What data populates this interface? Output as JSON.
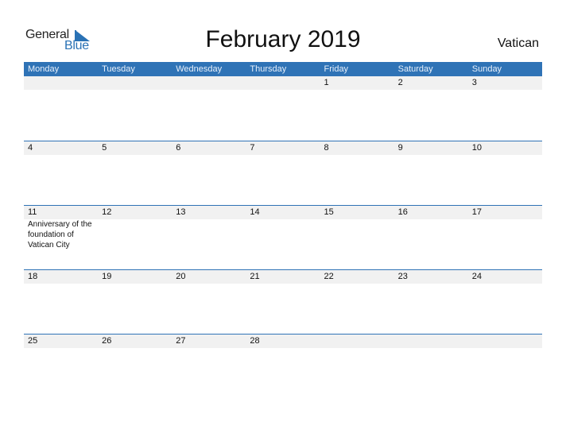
{
  "logo": {
    "word1": "General",
    "word2": "Blue"
  },
  "title": "February 2019",
  "country": "Vatican",
  "colors": {
    "header_bg": "#2f73b6",
    "date_strip_bg": "#f1f1f1",
    "logo_blue": "#2a72b5"
  },
  "weekdays": [
    "Monday",
    "Tuesday",
    "Wednesday",
    "Thursday",
    "Friday",
    "Saturday",
    "Sunday"
  ],
  "weeks": [
    {
      "days": [
        {
          "num": "",
          "event": ""
        },
        {
          "num": "",
          "event": ""
        },
        {
          "num": "",
          "event": ""
        },
        {
          "num": "",
          "event": ""
        },
        {
          "num": "1",
          "event": ""
        },
        {
          "num": "2",
          "event": ""
        },
        {
          "num": "3",
          "event": ""
        }
      ]
    },
    {
      "days": [
        {
          "num": "4",
          "event": ""
        },
        {
          "num": "5",
          "event": ""
        },
        {
          "num": "6",
          "event": ""
        },
        {
          "num": "7",
          "event": ""
        },
        {
          "num": "8",
          "event": ""
        },
        {
          "num": "9",
          "event": ""
        },
        {
          "num": "10",
          "event": ""
        }
      ]
    },
    {
      "days": [
        {
          "num": "11",
          "event": "Anniversary of the foundation of Vatican City"
        },
        {
          "num": "12",
          "event": ""
        },
        {
          "num": "13",
          "event": ""
        },
        {
          "num": "14",
          "event": ""
        },
        {
          "num": "15",
          "event": ""
        },
        {
          "num": "16",
          "event": ""
        },
        {
          "num": "17",
          "event": ""
        }
      ]
    },
    {
      "days": [
        {
          "num": "18",
          "event": ""
        },
        {
          "num": "19",
          "event": ""
        },
        {
          "num": "20",
          "event": ""
        },
        {
          "num": "21",
          "event": ""
        },
        {
          "num": "22",
          "event": ""
        },
        {
          "num": "23",
          "event": ""
        },
        {
          "num": "24",
          "event": ""
        }
      ]
    },
    {
      "days": [
        {
          "num": "25",
          "event": ""
        },
        {
          "num": "26",
          "event": ""
        },
        {
          "num": "27",
          "event": ""
        },
        {
          "num": "28",
          "event": ""
        },
        {
          "num": "",
          "event": ""
        },
        {
          "num": "",
          "event": ""
        },
        {
          "num": "",
          "event": ""
        }
      ]
    }
  ]
}
